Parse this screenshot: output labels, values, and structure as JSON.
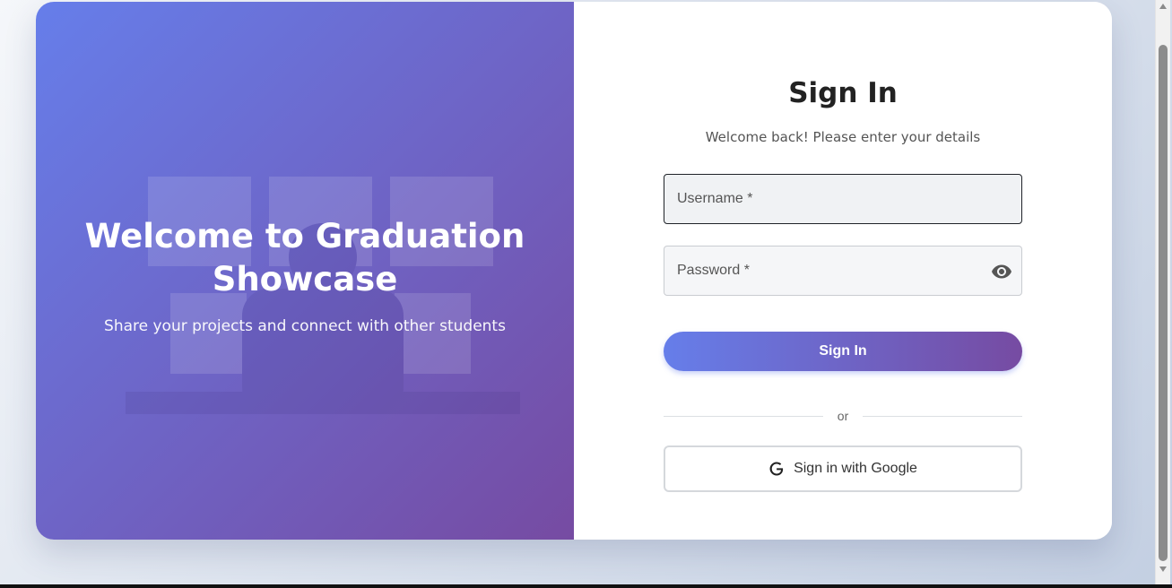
{
  "hero": {
    "title": "Welcome to Graduation Showcase",
    "subtitle": "Share your projects and connect with other students"
  },
  "form": {
    "title": "Sign In",
    "subtitle": "Welcome back! Please enter your details",
    "username_label": "Username *",
    "password_label": "Password *",
    "submit_label": "Sign In",
    "divider_text": "or",
    "google_label": "Sign in with Google"
  },
  "icons": {
    "password_toggle": "eye-icon",
    "google": "google-icon"
  },
  "colors": {
    "gradient_start": "#667eea",
    "gradient_end": "#764ba2"
  }
}
